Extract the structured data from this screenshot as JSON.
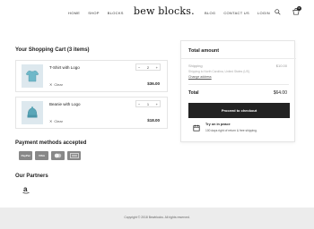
{
  "header": {
    "nav_left": [
      "HOME",
      "SHOP",
      "BLOCKS"
    ],
    "logo": "bew blocks.",
    "nav_right": [
      "BLOG",
      "CONTACT US",
      "LOGIN"
    ],
    "cart_count": "0",
    "icons": {
      "search": "search-icon",
      "cart": "cart-icon"
    }
  },
  "cart": {
    "title": "Your Shopping Cart (3 items)",
    "items": [
      {
        "name": "T-Shirt with Logo",
        "quantity": "2",
        "minus": "−",
        "plus": "+",
        "clear_label": "Clear",
        "price": "$36.00",
        "thumb_color": "#6fb8c9"
      },
      {
        "name": "Beanie with Logo",
        "quantity": "1",
        "minus": "−",
        "plus": "+",
        "clear_label": "Clear",
        "price": "$18.00",
        "thumb_color": "#5aa6b8"
      }
    ]
  },
  "summary": {
    "title": "Total amount",
    "shipping_label": "Shipping",
    "shipping_value": "$10.00",
    "shipping_note": "Shipping to North Carolina, United States (US).",
    "shipping_link": "Change address",
    "total_label": "Total",
    "total_value": "$64.00",
    "checkout_label": "Proceed to checkout",
    "promo_title": "Try on in peace",
    "promo_text": "100 days right of return & free shipping."
  },
  "payment": {
    "title": "Payment methods accepted",
    "methods": [
      "PayPal",
      "VISA",
      "MC",
      "AMEX"
    ]
  },
  "partners": {
    "title": "Our Partners",
    "icons": [
      "amazon-icon"
    ]
  },
  "footer": {
    "copyright": "Copyright © 2018 Bewblocks. All rights reserved."
  },
  "colors": {
    "dark": "#222222",
    "footer_bg": "#ececec",
    "border": "#e5e5e5"
  }
}
